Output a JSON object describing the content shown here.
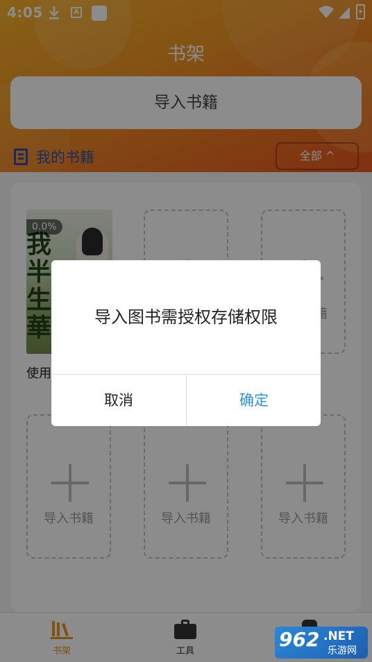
{
  "status_bar": {
    "time": "4:05",
    "a_badge": "A"
  },
  "header": {
    "title": "书架",
    "import_bar_label": "导入书籍"
  },
  "section": {
    "title": "我的书籍",
    "filter_label": "全部 ^"
  },
  "book": {
    "progress": "0.0%",
    "name": "使用",
    "cover_text": "我半生華"
  },
  "slots": [
    {
      "label": ""
    },
    {
      "label": ""
    },
    {
      "label": "导入书籍"
    },
    {
      "label": "导入书籍"
    },
    {
      "label": "导入书籍"
    }
  ],
  "slot_partial_text": "籍",
  "nav": {
    "shelf": "书架",
    "tools": "工具",
    "my": ""
  },
  "dialog": {
    "message": "导入图书需授权存储权限",
    "cancel": "取消",
    "confirm": "确定"
  },
  "watermark": {
    "brand": "962",
    "suffix": ".NET",
    "sub": "乐游网"
  },
  "colors": {
    "accent": "#e8951e",
    "confirm": "#2a95d6",
    "section": "#2c4fa8"
  }
}
